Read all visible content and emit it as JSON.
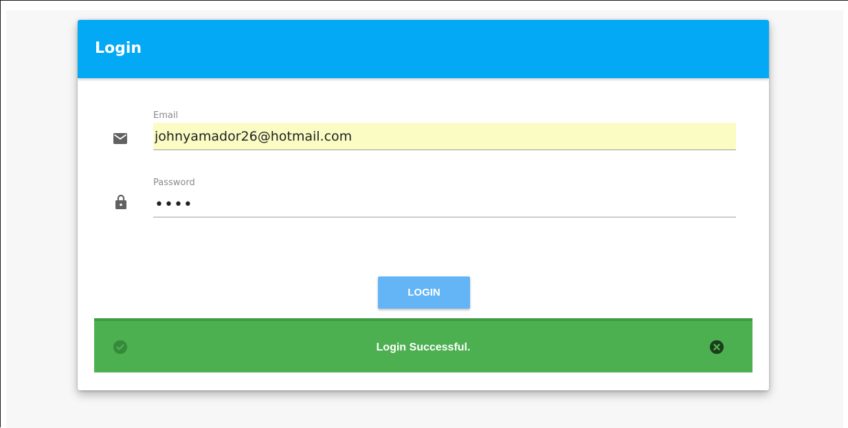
{
  "login_card": {
    "title": "Login",
    "email": {
      "label": "Email",
      "value": "johnyamador26@hotmail.com",
      "icon": "mail-icon"
    },
    "password": {
      "label": "Password",
      "value": "••••",
      "icon": "lock-icon"
    },
    "login_button_label": "LOGIN",
    "alert": {
      "message": "Login Successful.",
      "status_icon": "check-circle-icon",
      "close_icon": "close-circle-icon"
    }
  },
  "colors": {
    "header": "#03a9f4",
    "button": "#64b5f6",
    "success": "#4caf50",
    "autofill": "#fafcc4"
  }
}
